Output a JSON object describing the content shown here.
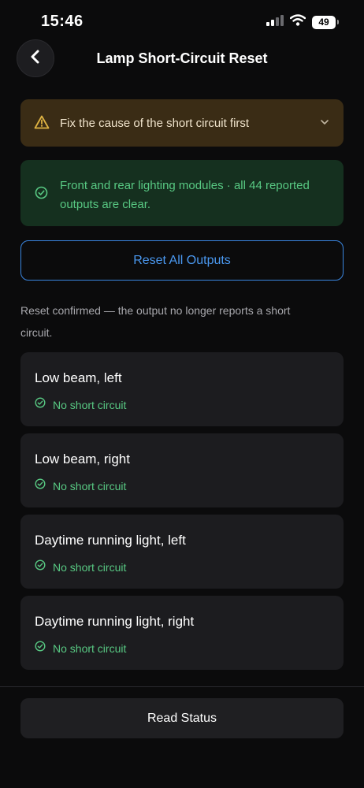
{
  "status_bar": {
    "time": "15:46",
    "battery": "49",
    "icons": [
      "signal-icon",
      "wifi-icon",
      "battery-icon"
    ]
  },
  "header": {
    "title": "Lamp Short-Circuit Reset",
    "back_icon": "chevron-left-icon"
  },
  "warning": {
    "text": "Fix the cause of the short circuit first",
    "icon": "warning-triangle-icon",
    "expand_icon": "chevron-down-icon",
    "color": "#e0b443"
  },
  "success": {
    "text": "Front and rear lighting modules · all 44 reported outputs are clear.",
    "icon": "check-circle-icon",
    "color": "#58c983"
  },
  "reset_button": {
    "label": "Reset All Outputs",
    "color": "#4a98f0"
  },
  "info": {
    "text": "Reset confirmed — the output no longer reports a short circuit."
  },
  "outputs": [
    {
      "name": "Low beam, left",
      "status": "No short circuit"
    },
    {
      "name": "Low beam, right",
      "status": "No short circuit"
    },
    {
      "name": "Daytime running light, left",
      "status": "No short circuit"
    },
    {
      "name": "Daytime running light, right",
      "status": "No short circuit"
    }
  ],
  "read_button": {
    "label": "Read Status"
  }
}
